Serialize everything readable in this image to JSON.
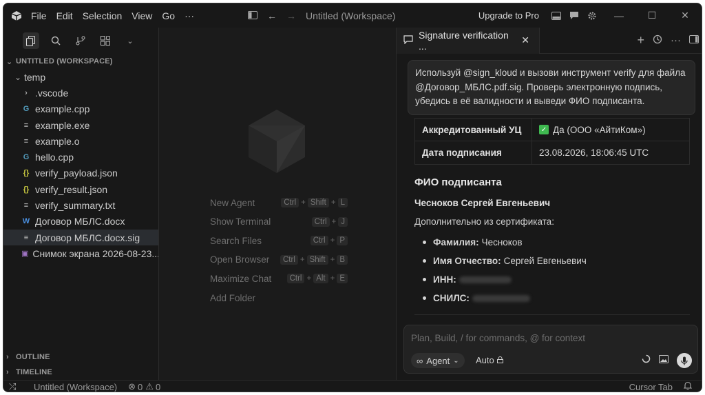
{
  "titlebar": {
    "menu": [
      "File",
      "Edit",
      "Selection",
      "View",
      "Go",
      "···"
    ],
    "title": "Untitled (Workspace)",
    "upgrade": "Upgrade to Pro"
  },
  "sidebar": {
    "workspace_header": "UNTITLED (WORKSPACE)",
    "folder": "temp",
    "items": [
      {
        "label": ".vscode",
        "icon": "chevron-right-icon"
      },
      {
        "label": "example.cpp",
        "icon": "cpp-file-icon"
      },
      {
        "label": "example.exe",
        "icon": "lines-file-icon"
      },
      {
        "label": "example.o",
        "icon": "lines-file-icon"
      },
      {
        "label": "hello.cpp",
        "icon": "cpp-file-icon"
      },
      {
        "label": "verify_payload.json",
        "icon": "json-file-icon"
      },
      {
        "label": "verify_result.json",
        "icon": "json-file-icon"
      },
      {
        "label": "verify_summary.txt",
        "icon": "lines-file-icon"
      },
      {
        "label": "Договор МБЛС.docx",
        "icon": "word-file-icon"
      },
      {
        "label": "Договор МБЛС.docx.sig",
        "icon": "lines-file-icon"
      },
      {
        "label": "Снимок экрана 2026-08-23...",
        "icon": "image-file-icon"
      }
    ],
    "outline": "OUTLINE",
    "timeline": "TIMELINE"
  },
  "center": {
    "shortcuts": [
      {
        "label": "New Agent",
        "keys": [
          "Ctrl",
          "Shift",
          "L"
        ]
      },
      {
        "label": "Show Terminal",
        "keys": [
          "Ctrl",
          "J"
        ]
      },
      {
        "label": "Search Files",
        "keys": [
          "Ctrl",
          "P"
        ]
      },
      {
        "label": "Open Browser",
        "keys": [
          "Ctrl",
          "Shift",
          "B"
        ]
      },
      {
        "label": "Maximize Chat",
        "keys": [
          "Ctrl",
          "Alt",
          "E"
        ]
      },
      {
        "label": "Add Folder",
        "keys": []
      }
    ]
  },
  "chat": {
    "tab_title": "Signature verification ...",
    "user_message": "Используй @sign_kloud и вызови инструмент verify для файла @Договор_МБЛС.pdf.sig. Проверь электронную подпись, убедись в её валидности и выведи ФИО подписанта.",
    "table": [
      {
        "key": "Аккредитованный УЦ",
        "value": "Да (ООО «АйтиКом»)",
        "checked": true
      },
      {
        "key": "Дата подписания",
        "value": "23.08.2026, 18:06:45 UTC",
        "checked": false
      }
    ],
    "heading": "ФИО подписанта",
    "signer_name": "Чесноков Сергей Евгеньевич",
    "extra_label": "Дополнительно из сертификата:",
    "bullets": [
      {
        "key": "Фамилия:",
        "value": "Чесноков",
        "redacted": false
      },
      {
        "key": "Имя Отчество:",
        "value": "Сергей Евгеньевич",
        "redacted": false
      },
      {
        "key": "ИНН:",
        "value": "",
        "redacted": true
      },
      {
        "key": "СНИЛС:",
        "value": "",
        "redacted": true
      }
    ],
    "composer_placeholder": "Plan, Build, / for commands, @ for context",
    "agent_label": "Agent",
    "auto_label": "Auto"
  },
  "statusbar": {
    "workspace": "Untitled (Workspace)",
    "errors": "0",
    "warnings": "0",
    "right": "Cursor Tab"
  },
  "colors": {
    "check": "#3fb950",
    "background": "#181818"
  }
}
